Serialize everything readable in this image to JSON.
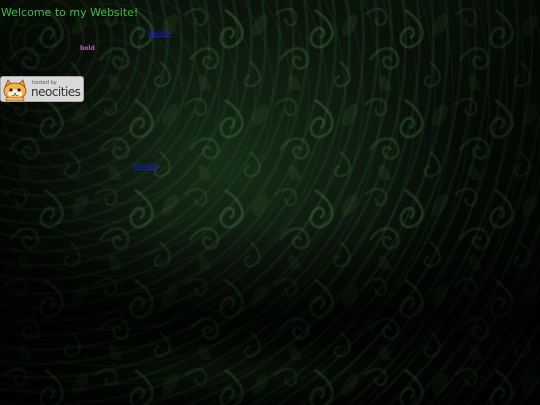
{
  "page": {
    "title": "Welcome to my Website!",
    "link_top": "Website",
    "bold_text": "bold",
    "link_bottom": "Website"
  },
  "badge": {
    "hosted_label": "hosted by",
    "brand_label": "neocities",
    "icon": "neocities-cat-icon"
  },
  "colors": {
    "title": "#3fb94a",
    "link": "#1a1ad8",
    "bold_text": "#d24ad2",
    "background": "#050805"
  }
}
